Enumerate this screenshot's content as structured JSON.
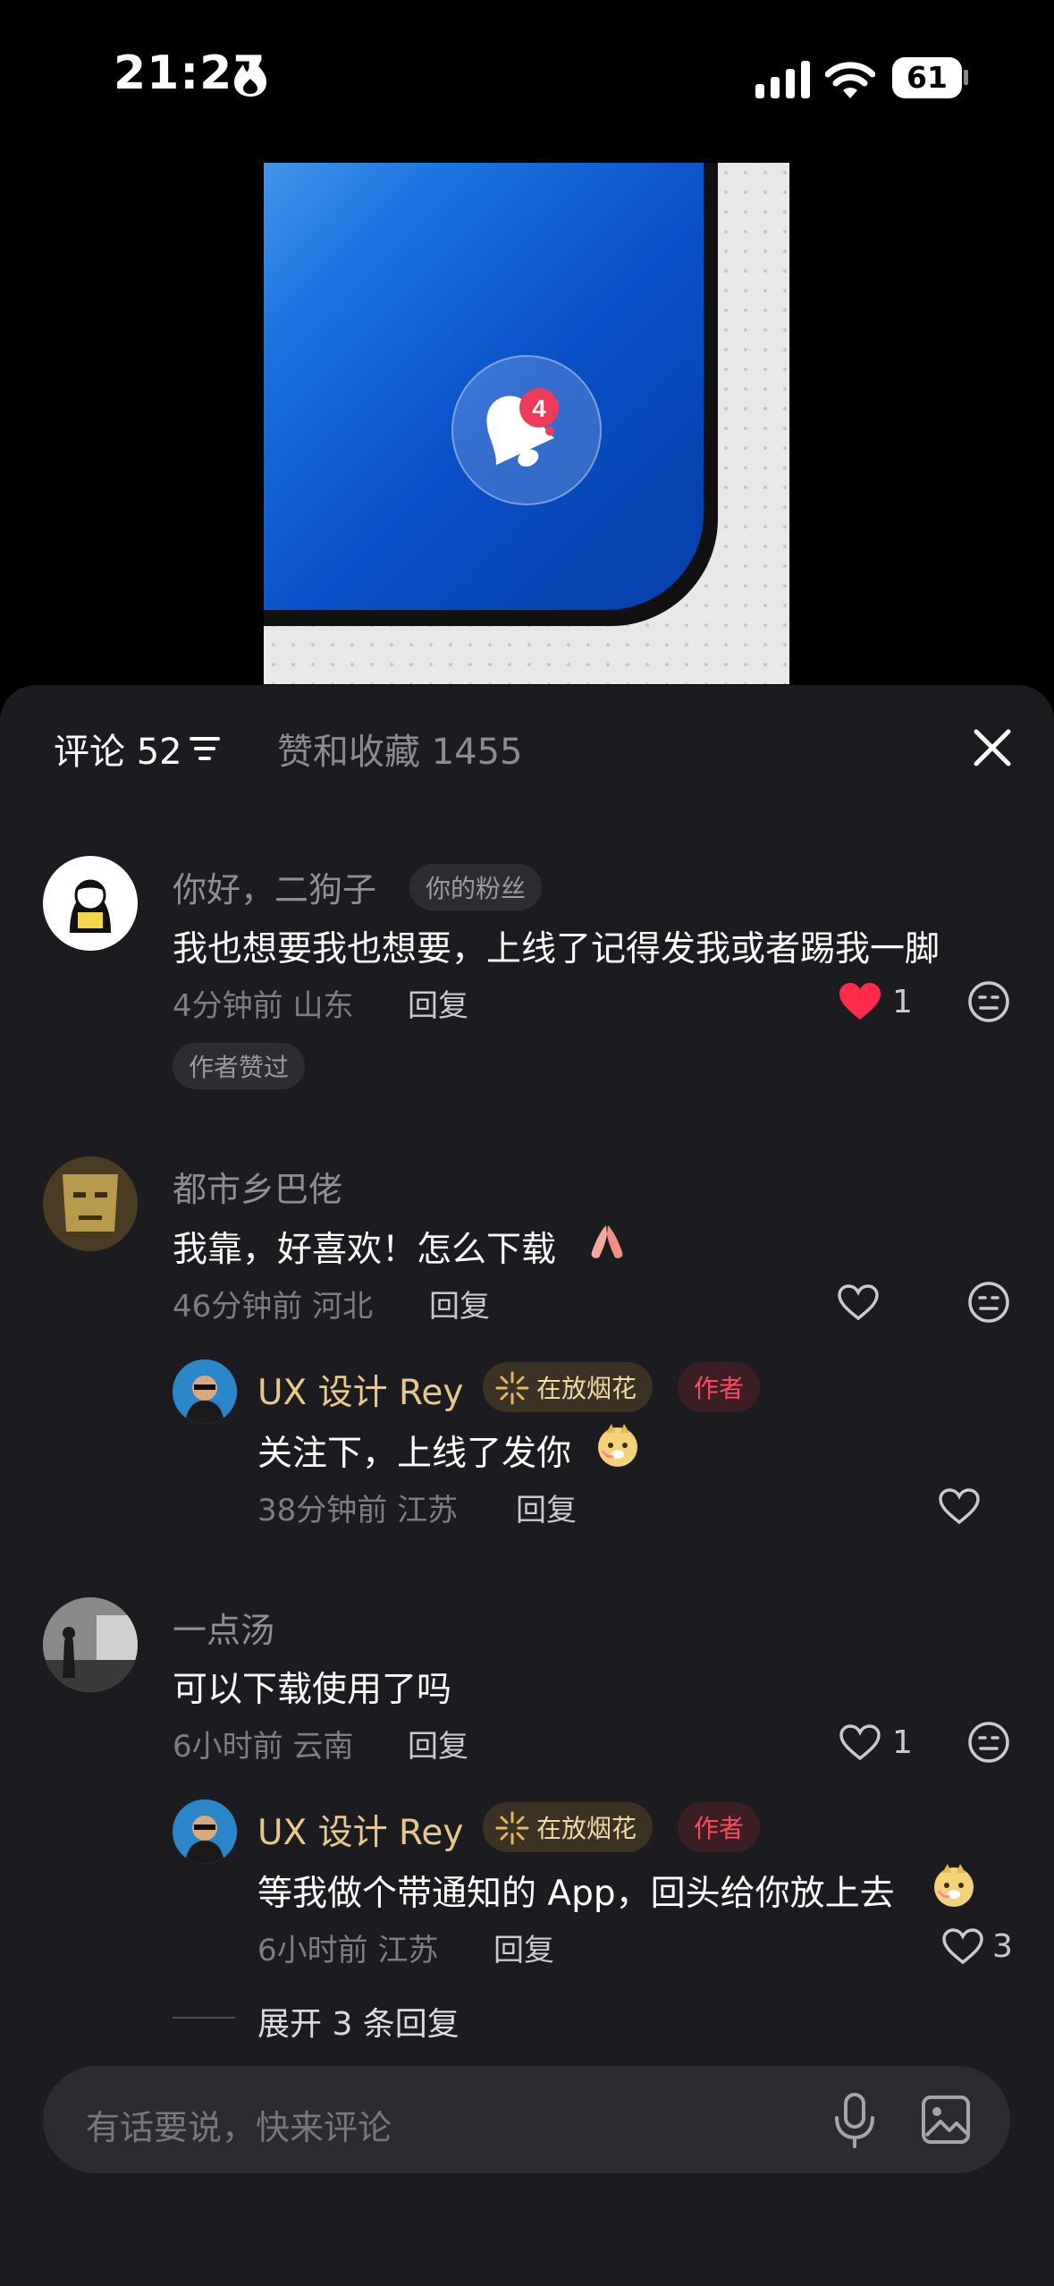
{
  "status": {
    "time": "21:27",
    "battery": "61"
  },
  "media": {
    "bell_count": "4"
  },
  "tabs": {
    "comments_label": "评论 52",
    "likes_label": "赞和收藏 1455"
  },
  "comments": [
    {
      "name": "你好，二狗子",
      "fan_badge": "你的粉丝",
      "text": "我也想要我也想要，上线了记得发我或者踢我一脚",
      "time": "4分钟前 山东",
      "reply": "回复",
      "likes": "1",
      "tag": "作者赞过"
    },
    {
      "name": "都市乡巴佬",
      "text": "我靠，好喜欢！怎么下载",
      "time": "46分钟前 河北",
      "reply": "回复"
    },
    {
      "name": "一点汤",
      "text": "可以下载使用了吗",
      "time": "6小时前 云南",
      "reply": "回复",
      "likes": "1"
    }
  ],
  "replies": [
    {
      "name": "UX 设计 Rey",
      "status": "在放烟花",
      "role": "作者",
      "text": "关注下，上线了发你",
      "time": "38分钟前 江苏",
      "reply": "回复"
    },
    {
      "name": "UX 设计 Rey",
      "status": "在放烟花",
      "role": "作者",
      "text": "等我做个带通知的 App，回头给你放上去",
      "time": "6小时前 江苏",
      "reply": "回复",
      "likes": "3"
    }
  ],
  "expand_label": "展开 3 条回复",
  "input": {
    "placeholder": "有话要说，快来评论"
  },
  "colors": {
    "sheet": "#1c1c20",
    "author_gold": "#e8c78a",
    "heart_red": "#ff2b48"
  }
}
